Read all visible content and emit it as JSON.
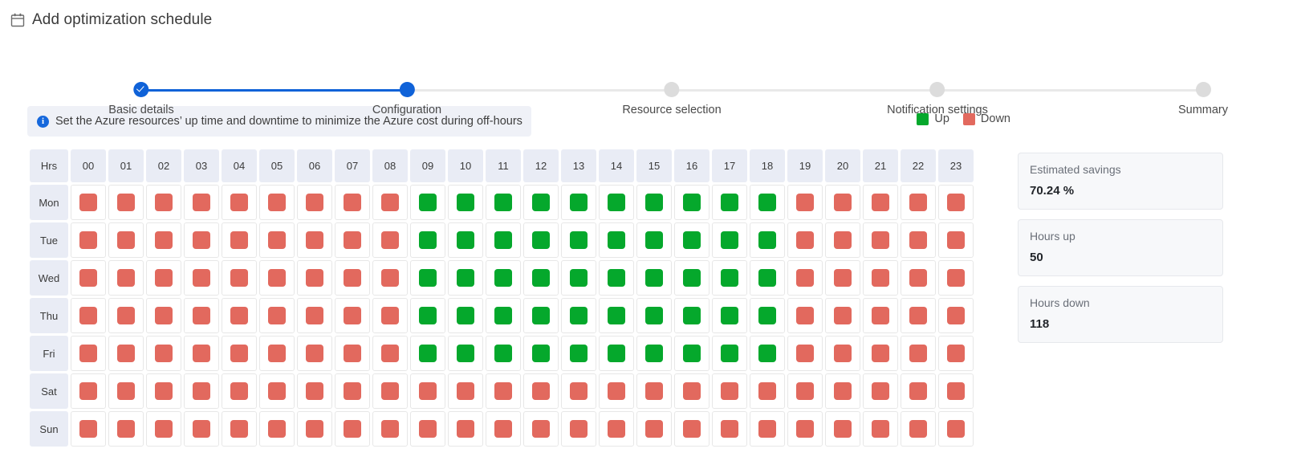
{
  "header": {
    "icon": "calendar-icon",
    "title": "Add optimization schedule"
  },
  "stepper": {
    "steps": [
      {
        "label": "Basic details",
        "state": "complete"
      },
      {
        "label": "Configuration",
        "state": "current"
      },
      {
        "label": "Resource selection",
        "state": "upcoming"
      },
      {
        "label": "Notification settings",
        "state": "upcoming"
      },
      {
        "label": "Summary",
        "state": "upcoming"
      }
    ],
    "accent_color": "#0f62d8",
    "inactive_color": "#dcdcdc"
  },
  "banner": {
    "icon": "info-icon",
    "icon_glyph": "i",
    "text": "Set the Azure resources’ up time and downtime to minimize the Azure cost during off-hours"
  },
  "legend": {
    "items": [
      {
        "label": "Up",
        "color": "#05a82c"
      },
      {
        "label": "Down",
        "color": "#e2695e"
      }
    ]
  },
  "schedule": {
    "corner_label": "Hrs",
    "hours": [
      "00",
      "01",
      "02",
      "03",
      "04",
      "05",
      "06",
      "07",
      "08",
      "09",
      "10",
      "11",
      "12",
      "13",
      "14",
      "15",
      "16",
      "17",
      "18",
      "19",
      "20",
      "21",
      "22",
      "23"
    ],
    "days": [
      "Mon",
      "Tue",
      "Wed",
      "Thu",
      "Fri",
      "Sat",
      "Sun"
    ],
    "states": {
      "Mon": [
        "down",
        "down",
        "down",
        "down",
        "down",
        "down",
        "down",
        "down",
        "down",
        "up",
        "up",
        "up",
        "up",
        "up",
        "up",
        "up",
        "up",
        "up",
        "up",
        "down",
        "down",
        "down",
        "down",
        "down"
      ],
      "Tue": [
        "down",
        "down",
        "down",
        "down",
        "down",
        "down",
        "down",
        "down",
        "down",
        "up",
        "up",
        "up",
        "up",
        "up",
        "up",
        "up",
        "up",
        "up",
        "up",
        "down",
        "down",
        "down",
        "down",
        "down"
      ],
      "Wed": [
        "down",
        "down",
        "down",
        "down",
        "down",
        "down",
        "down",
        "down",
        "down",
        "up",
        "up",
        "up",
        "up",
        "up",
        "up",
        "up",
        "up",
        "up",
        "up",
        "down",
        "down",
        "down",
        "down",
        "down"
      ],
      "Thu": [
        "down",
        "down",
        "down",
        "down",
        "down",
        "down",
        "down",
        "down",
        "down",
        "up",
        "up",
        "up",
        "up",
        "up",
        "up",
        "up",
        "up",
        "up",
        "up",
        "down",
        "down",
        "down",
        "down",
        "down"
      ],
      "Fri": [
        "down",
        "down",
        "down",
        "down",
        "down",
        "down",
        "down",
        "down",
        "down",
        "up",
        "up",
        "up",
        "up",
        "up",
        "up",
        "up",
        "up",
        "up",
        "up",
        "down",
        "down",
        "down",
        "down",
        "down"
      ],
      "Sat": [
        "down",
        "down",
        "down",
        "down",
        "down",
        "down",
        "down",
        "down",
        "down",
        "down",
        "down",
        "down",
        "down",
        "down",
        "down",
        "down",
        "down",
        "down",
        "down",
        "down",
        "down",
        "down",
        "down",
        "down"
      ],
      "Sun": [
        "down",
        "down",
        "down",
        "down",
        "down",
        "down",
        "down",
        "down",
        "down",
        "down",
        "down",
        "down",
        "down",
        "down",
        "down",
        "down",
        "down",
        "down",
        "down",
        "down",
        "down",
        "down",
        "down",
        "down"
      ]
    }
  },
  "summary": {
    "cards": [
      {
        "label": "Estimated savings",
        "value": "70.24 %"
      },
      {
        "label": "Hours up",
        "value": "50"
      },
      {
        "label": "Hours down",
        "value": "118"
      }
    ]
  }
}
